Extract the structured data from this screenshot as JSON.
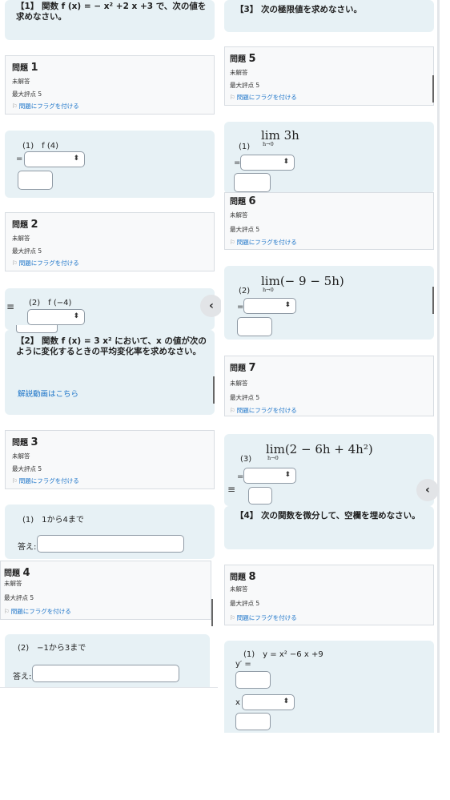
{
  "left": {
    "q1_header": "【1】 関数 f (x) = − x² +2 x +3 で、次の値を求めなさい。",
    "q1": {
      "label": "問題",
      "num": "1",
      "status": "未解答",
      "max": "最大評点 5",
      "flag": "問題にフラグを付ける"
    },
    "part1": "(1)　f (4)",
    "eq": "=",
    "q2": {
      "label": "問題",
      "num": "2",
      "status": "未解答",
      "max": "最大評点 5",
      "flag": "問題にフラグを付ける"
    },
    "part2": "(2)　f (−4)",
    "q2_header": "【2】 関数 f (x) = 3 x² において、x の値が次のように変化するときの平均変化率を求めなさい。",
    "video_link": "解説動画はこちら",
    "q3": {
      "label": "問題",
      "num": "3",
      "status": "未解答",
      "max": "最大評点 5",
      "flag": "問題にフラグを付ける"
    },
    "part3": "(1)　1から4まで",
    "answer_label": "答え:",
    "q4": {
      "label": "問題",
      "num": "4",
      "status": "未解答",
      "max": "最大評点 5",
      "flag": "問題にフラグを付ける"
    },
    "part4": "(2)　−1から3まで"
  },
  "right": {
    "q3_header": "【3】 次の極限値を求めなさい。",
    "q5": {
      "label": "問題",
      "num": "5",
      "status": "未解答",
      "max": "最大評点 5",
      "flag": "問題にフラグを付ける"
    },
    "limit1": {
      "num": "(1)",
      "expr": "lim 3h",
      "sub": "h→0"
    },
    "eq": "=",
    "q6": {
      "label": "問題",
      "num": "6",
      "status": "未解答",
      "max": "最大評点 5",
      "flag": "問題にフラグを付ける"
    },
    "limit2": {
      "num": "(2)",
      "expr": "lim(− 9 − 5h)",
      "sub": "h→0"
    },
    "q7": {
      "label": "問題",
      "num": "7",
      "status": "未解答",
      "max": "最大評点 5",
      "flag": "問題にフラグを付ける"
    },
    "limit3": {
      "num": "(3)",
      "expr": "lim(2 − 6h + 4h²)",
      "sub": "h→0"
    },
    "q4_header": "【4】 次の関数を微分して、空欄を埋めなさい。",
    "q8": {
      "label": "問題",
      "num": "8",
      "status": "未解答",
      "max": "最大評点 5",
      "flag": "問題にフラグを付ける"
    },
    "func1": "(1)　y = x² −6 x +9",
    "yprime": "y′ =",
    "x_label": "x"
  },
  "icons": {
    "menu": "menu-icon",
    "collapse": "chevron-left-icon",
    "flag": "flag-icon",
    "select": "select-arrows-icon"
  },
  "select_arrow": "⬍"
}
